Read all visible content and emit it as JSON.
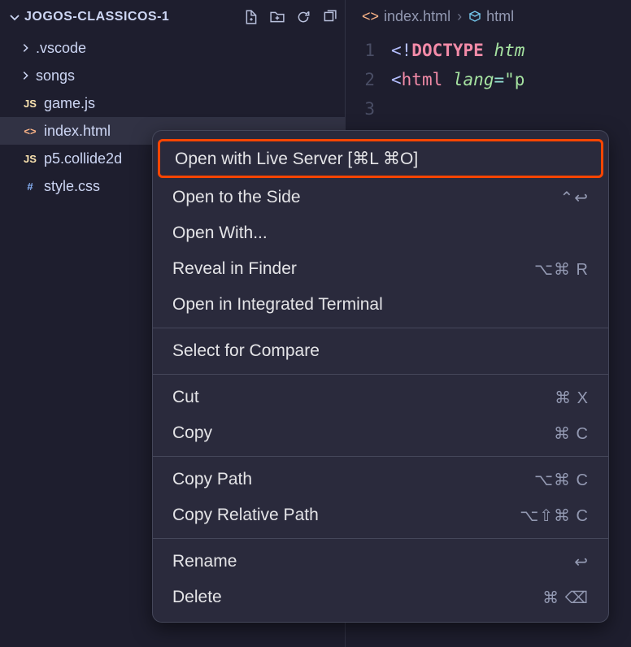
{
  "sidebar": {
    "project_title": "JOGOS-CLASSICOS-1",
    "folders": [
      {
        "name": ".vscode"
      },
      {
        "name": "songs"
      }
    ],
    "files": [
      {
        "name": "game.js",
        "type": "js"
      },
      {
        "name": "index.html",
        "type": "html",
        "selected": true
      },
      {
        "name": "p5.collide2d",
        "type": "js"
      },
      {
        "name": "style.css",
        "type": "css"
      }
    ]
  },
  "breadcrumb": {
    "file": "index.html",
    "symbol": "html"
  },
  "code": {
    "lines": [
      "1",
      "2",
      "3"
    ],
    "line1": {
      "open": "<!",
      "doctype": "DOCTYPE",
      "sp": " ",
      "kw": "htm"
    },
    "line2": {
      "open": "<",
      "tag": "html",
      "sp": " ",
      "attr": "lang",
      "eq": "=",
      "str": "\"p"
    }
  },
  "context_menu": {
    "items": [
      {
        "label": "Open with Live Server [⌘L ⌘O]",
        "shortcut": "",
        "highlighted": true
      },
      {
        "label": "Open to the Side",
        "shortcut": "⌃↩"
      },
      {
        "label": "Open With...",
        "shortcut": ""
      },
      {
        "label": "Reveal in Finder",
        "shortcut": "⌥⌘ R"
      },
      {
        "label": "Open in Integrated Terminal",
        "shortcut": ""
      },
      {
        "sep": true
      },
      {
        "label": "Select for Compare",
        "shortcut": ""
      },
      {
        "sep": true
      },
      {
        "label": "Cut",
        "shortcut": "⌘ X"
      },
      {
        "label": "Copy",
        "shortcut": "⌘ C"
      },
      {
        "sep": true
      },
      {
        "label": "Copy Path",
        "shortcut": "⌥⌘ C"
      },
      {
        "label": "Copy Relative Path",
        "shortcut": "⌥⇧⌘ C"
      },
      {
        "sep": true
      },
      {
        "label": "Rename",
        "shortcut": "↩"
      },
      {
        "label": "Delete",
        "shortcut": "⌘ ⌫"
      }
    ]
  }
}
